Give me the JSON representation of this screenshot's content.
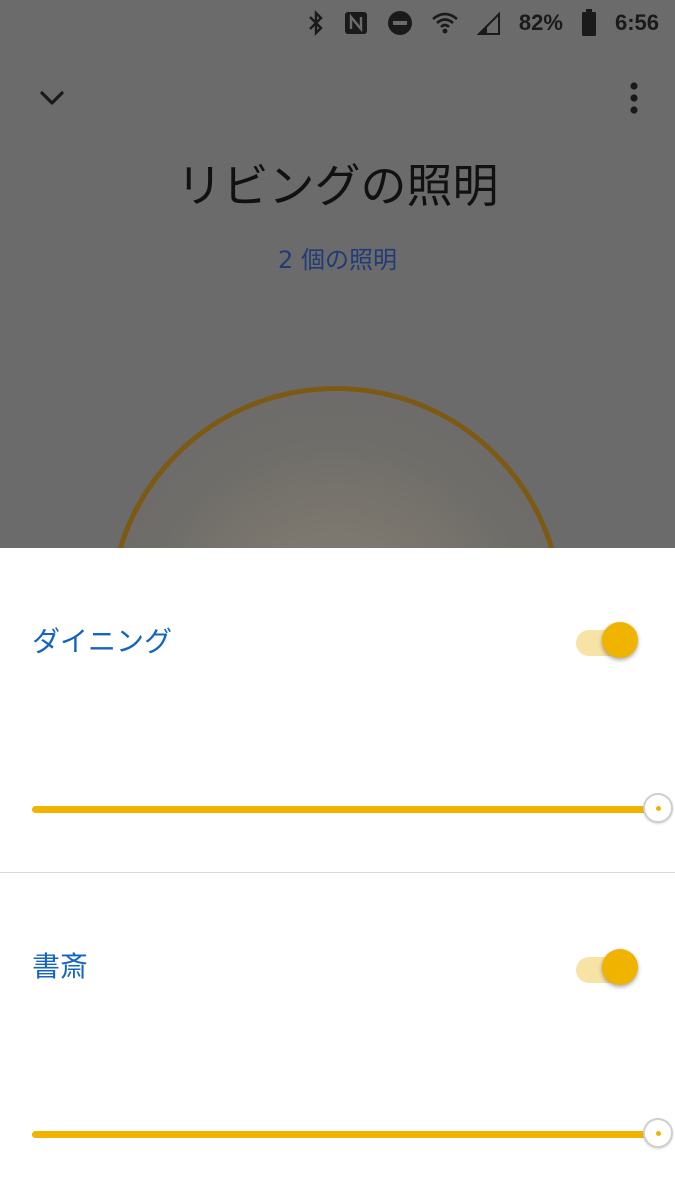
{
  "status_bar": {
    "battery_percent": "82%",
    "time": "6:56",
    "icons": [
      "bluetooth-icon",
      "nfc-icon",
      "do-not-disturb-icon",
      "wifi-icon",
      "signal-icon",
      "battery-icon"
    ]
  },
  "header": {
    "title": "リビングの照明",
    "subtitle": "2 個の照明"
  },
  "colors": {
    "accent": "#f0b400",
    "link": "#1565c0",
    "scrim": "#6b6b6b"
  },
  "lights": [
    {
      "name": "ダイニング",
      "on": true,
      "brightness": 1.0
    },
    {
      "name": "書斎",
      "on": true,
      "brightness": 1.0
    }
  ]
}
